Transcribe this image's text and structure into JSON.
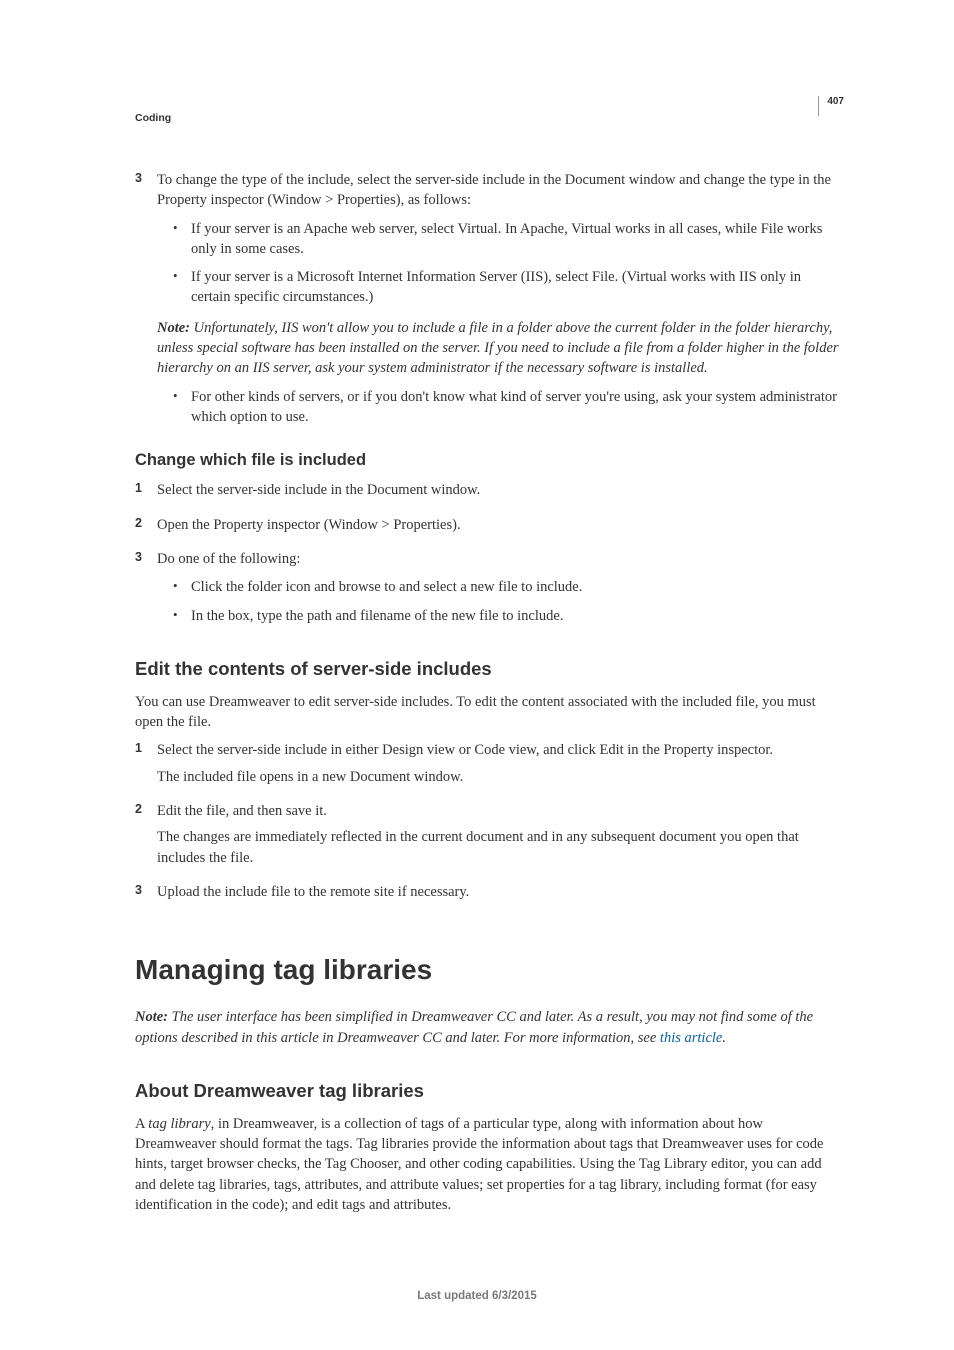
{
  "page_number": "407",
  "chapter": "Coding",
  "step3": {
    "num": "3",
    "text": "To change the type of the include, select the server-side include in the Document window and change the type in the Property inspector (Window > Properties), as follows:",
    "b1": "If your server is an Apache web server, select Virtual. In Apache, Virtual works in all cases, while File works only in some cases.",
    "b2": "If your server is a Microsoft Internet Information Server (IIS), select File. (Virtual works with IIS only in certain specific circumstances.)",
    "note_label": "Note:",
    "note_text": " Unfortunately, IIS won't allow you to include a file in a folder above the current folder in the folder hierarchy, unless special software has been installed on the server. If you need to include a file from a folder higher in the folder hierarchy on an IIS server, ask your system administrator if the necessary software is installed.",
    "b3": "For other kinds of servers, or if you don't know what kind of server you're using, ask your system administrator which option to use."
  },
  "sec_change": {
    "title": "Change which file is included",
    "s1": {
      "num": "1",
      "text": "Select the server-side include in the Document window."
    },
    "s2": {
      "num": "2",
      "text": "Open the Property inspector (Window > Properties)."
    },
    "s3": {
      "num": "3",
      "text": "Do one of the following:",
      "b1": "Click the folder icon and browse to and select a new file to include.",
      "b2": "In the box, type the path and filename of the new file to include."
    }
  },
  "sec_edit": {
    "title": "Edit the contents of server-side includes",
    "intro": "You can use Dreamweaver to edit server-side includes. To edit the content associated with the included file, you must open the file.",
    "s1": {
      "num": "1",
      "text": "Select the server-side include in either Design view or Code view, and click Edit in the Property inspector.",
      "sub": "The included file opens in a new Document window."
    },
    "s2": {
      "num": "2",
      "text": "Edit the file, and then save it.",
      "sub": "The changes are immediately reflected in the current document and in any subsequent document you open that includes the file."
    },
    "s3": {
      "num": "3",
      "text": "Upload the include file to the remote site if necessary."
    }
  },
  "sec_tag": {
    "title": "Managing tag libraries",
    "note_label": "Note:",
    "note_text_a": " The user interface has been simplified in Dreamweaver CC and later. As a result, you may not find some of the options described in this article in Dreamweaver CC and later. For more information, see ",
    "note_link": "this article",
    "note_text_b": ".",
    "h2": "About Dreamweaver tag libraries",
    "para_a": "A ",
    "para_ital": "tag library",
    "para_b": ", in Dreamweaver, is a collection of tags of a particular type, along with information about how Dreamweaver should format the tags. Tag libraries provide the information about tags that Dreamweaver uses for code hints, target browser checks, the Tag Chooser, and other coding capabilities. Using the Tag Library editor, you can add and delete tag libraries, tags, attributes, and attribute values; set properties for a tag library, including format (for easy identification in the code); and edit tags and attributes."
  },
  "footer": "Last updated 6/3/2015"
}
